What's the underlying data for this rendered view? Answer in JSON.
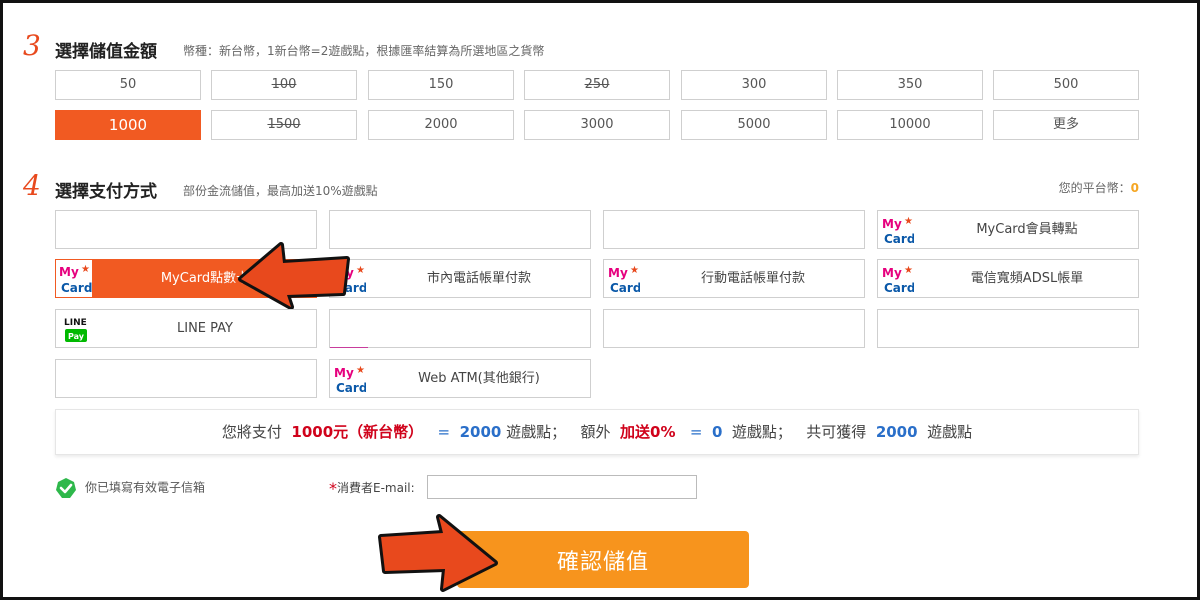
{
  "section3": {
    "number": "3",
    "title": "選擇儲值金額",
    "note": "幣種：新台幣，1新台幣=2遊戲點，根據匯率結算為所選地區之貨幣"
  },
  "amounts": [
    {
      "label": "50"
    },
    {
      "label": "100",
      "strike": true
    },
    {
      "label": "150"
    },
    {
      "label": "250",
      "strike": true
    },
    {
      "label": "300"
    },
    {
      "label": "350"
    },
    {
      "label": "500"
    },
    {
      "label": "1000",
      "selected": true
    },
    {
      "label": "1500",
      "strike": true
    },
    {
      "label": "2000"
    },
    {
      "label": "3000"
    },
    {
      "label": "5000"
    },
    {
      "label": "10000"
    },
    {
      "label": "更多"
    }
  ],
  "section4": {
    "number": "4",
    "title": "選擇支付方式",
    "note": "部份金流儲值，最高加送10%遊戲點"
  },
  "balance": {
    "label": "您的平台幣：",
    "value": "0"
  },
  "payments": {
    "mycard_points": "MyCard會員轉點",
    "mycard_card": "MyCard點數卡",
    "local_phone": "市內電話帳單付款",
    "mobile_phone": "行動電話帳單付款",
    "adsl": "電信寬頻ADSL帳單",
    "line_pay": "LINE PAY",
    "web_atm": "Web ATM(其他銀行)"
  },
  "summary": {
    "p1": "您將支付",
    "amount": "1000元（新台幣）",
    "eq1": "=",
    "points": "2000",
    "unit1": "遊戲點；",
    "extra_label": "額外",
    "bonus": "加送0%",
    "eq2": "=",
    "bonus_points": "0",
    "unit2": "遊戲點；",
    "total_label": "共可獲得",
    "total": "2000",
    "unit3": "遊戲點"
  },
  "email": {
    "ok_text": "你已填寫有效電子信箱",
    "star": "*",
    "label": "消費者E-mail:",
    "value": ""
  },
  "confirm_label": "確認儲值",
  "logo_text": {
    "my": "My",
    "card": "Card",
    "line": "LINE",
    "pay": "Pay"
  },
  "colors": {
    "accent": "#f15a22",
    "confirm": "#f7941d",
    "red": "#d0021b",
    "blue": "#2a6fc9",
    "gold": "#f5a623",
    "check": "#2eb84b"
  }
}
